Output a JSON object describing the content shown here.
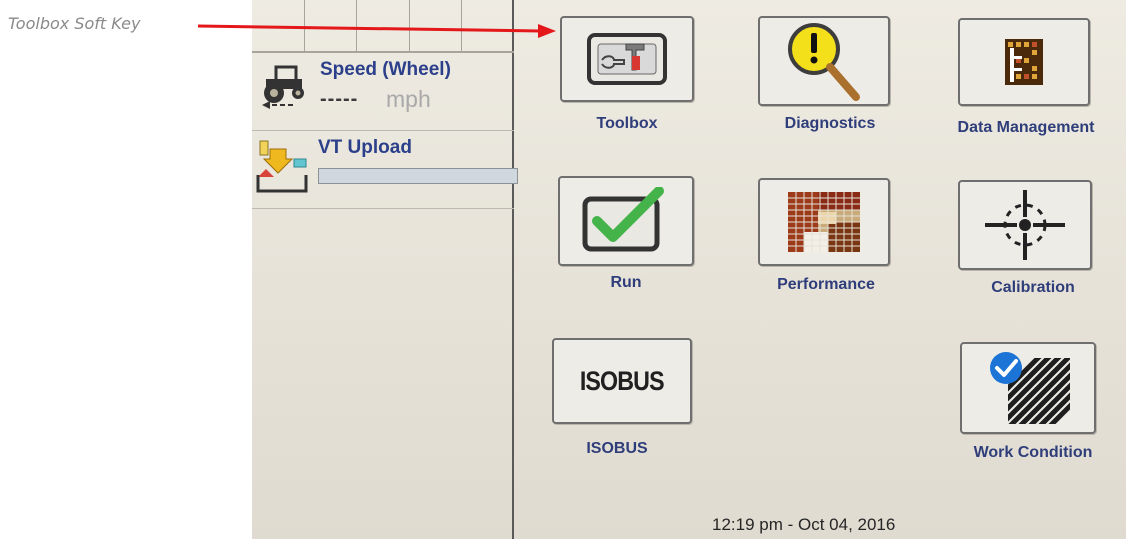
{
  "callout": {
    "label": "Toolbox Soft Key",
    "arrow_color": "#e4171b"
  },
  "status": {
    "speed": {
      "title": "Speed (Wheel)",
      "value": "-----",
      "unit": "mph",
      "icon": "tractor-speed-icon"
    },
    "upload": {
      "title": "VT Upload",
      "progress": 0,
      "icon": "vt-upload-icon"
    }
  },
  "softkeys": {
    "toolbox": {
      "label": "Toolbox",
      "icon": "toolbox-icon"
    },
    "diagnostics": {
      "label": "Diagnostics",
      "icon": "diagnostics-magnifier-icon"
    },
    "data_management": {
      "label": "Data Management",
      "icon": "data-management-icon"
    },
    "run": {
      "label": "Run",
      "icon": "checkmark-icon"
    },
    "performance": {
      "label": "Performance",
      "icon": "performance-grid-icon"
    },
    "calibration": {
      "label": "Calibration",
      "icon": "crosshair-icon"
    },
    "isobus": {
      "label": "ISOBUS",
      "icon_text": "ISOBUS"
    },
    "work_condition": {
      "label": "Work Condition",
      "icon": "work-condition-check-icon"
    }
  },
  "footer": {
    "timestamp": "12:19 pm - Oct 04, 2016"
  },
  "colors": {
    "label_blue": "#2f3e7a",
    "title_blue": "#2b3f8a",
    "check_green": "#44b34a",
    "badge_blue": "#1b74d6"
  }
}
